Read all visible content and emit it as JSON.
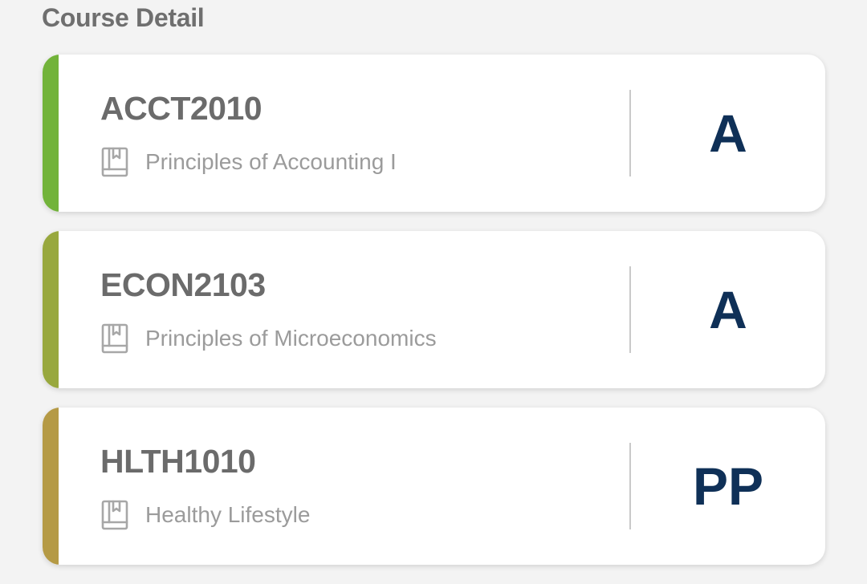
{
  "page": {
    "title": "Course Detail"
  },
  "courses": [
    {
      "code": "ACCT2010",
      "name": "Principles of Accounting I",
      "grade": "A",
      "accent_color": "#72b33a",
      "icon": "book-icon"
    },
    {
      "code": "ECON2103",
      "name": "Principles of Microeconomics",
      "grade": "A",
      "accent_color": "#98a83e",
      "icon": "book-icon"
    },
    {
      "code": "HLTH1010",
      "name": "Healthy Lifestyle",
      "grade": "PP",
      "accent_color": "#b59a45",
      "icon": "book-icon"
    }
  ],
  "colors": {
    "grade_text": "#0f3057",
    "background": "#f3f3f3"
  }
}
